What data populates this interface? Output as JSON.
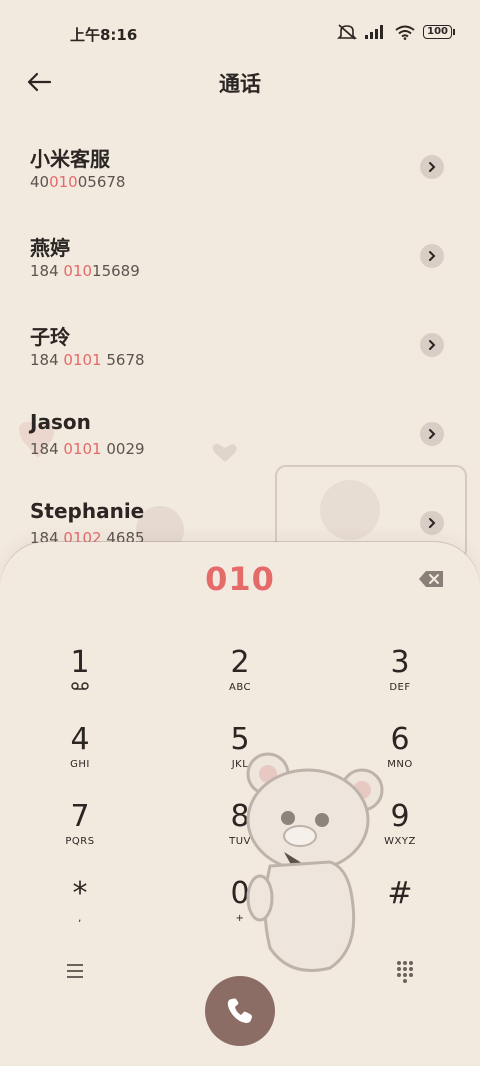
{
  "status": {
    "time": "上午8:16",
    "battery": "100"
  },
  "header": {
    "title": "通话"
  },
  "contacts": [
    {
      "name": "小米客服",
      "num_pre": "40",
      "num_hl": "010",
      "num_post": "05678"
    },
    {
      "name": "燕婷",
      "num_pre": "184 ",
      "num_hl": "010",
      "num_post": "15689"
    },
    {
      "name": "子玲",
      "num_pre": "184 ",
      "num_hl": "0101",
      "num_post": " 5678"
    },
    {
      "name": "Jason",
      "num_pre": "184 ",
      "num_hl": "0101",
      "num_post": " 0029"
    },
    {
      "name": "Stephanie",
      "num_pre": "184 ",
      "num_hl": "0102",
      "num_post": " 4685"
    }
  ],
  "dialpad": {
    "entered": "010",
    "keys": [
      {
        "digit": "1",
        "letters": ""
      },
      {
        "digit": "2",
        "letters": "ABC"
      },
      {
        "digit": "3",
        "letters": "DEF"
      },
      {
        "digit": "4",
        "letters": "GHI"
      },
      {
        "digit": "5",
        "letters": "JKL"
      },
      {
        "digit": "6",
        "letters": "MNO"
      },
      {
        "digit": "7",
        "letters": "PQRS"
      },
      {
        "digit": "8",
        "letters": "TUV"
      },
      {
        "digit": "9",
        "letters": "WXYZ"
      },
      {
        "digit": "*",
        "letters": ","
      },
      {
        "digit": "0",
        "letters": "+"
      },
      {
        "digit": "#",
        "letters": ""
      }
    ]
  },
  "icons": {
    "back": "back-arrow-icon",
    "chevron": "chevron-right-icon",
    "backspace": "backspace-icon",
    "voicemail": "voicemail-icon",
    "menu": "menu-icon",
    "dialpad": "dialpad-icon",
    "call": "phone-icon"
  },
  "colors": {
    "accent": "#e56a6a",
    "background": "#f2e9df",
    "call_button": "#8c6d66"
  }
}
